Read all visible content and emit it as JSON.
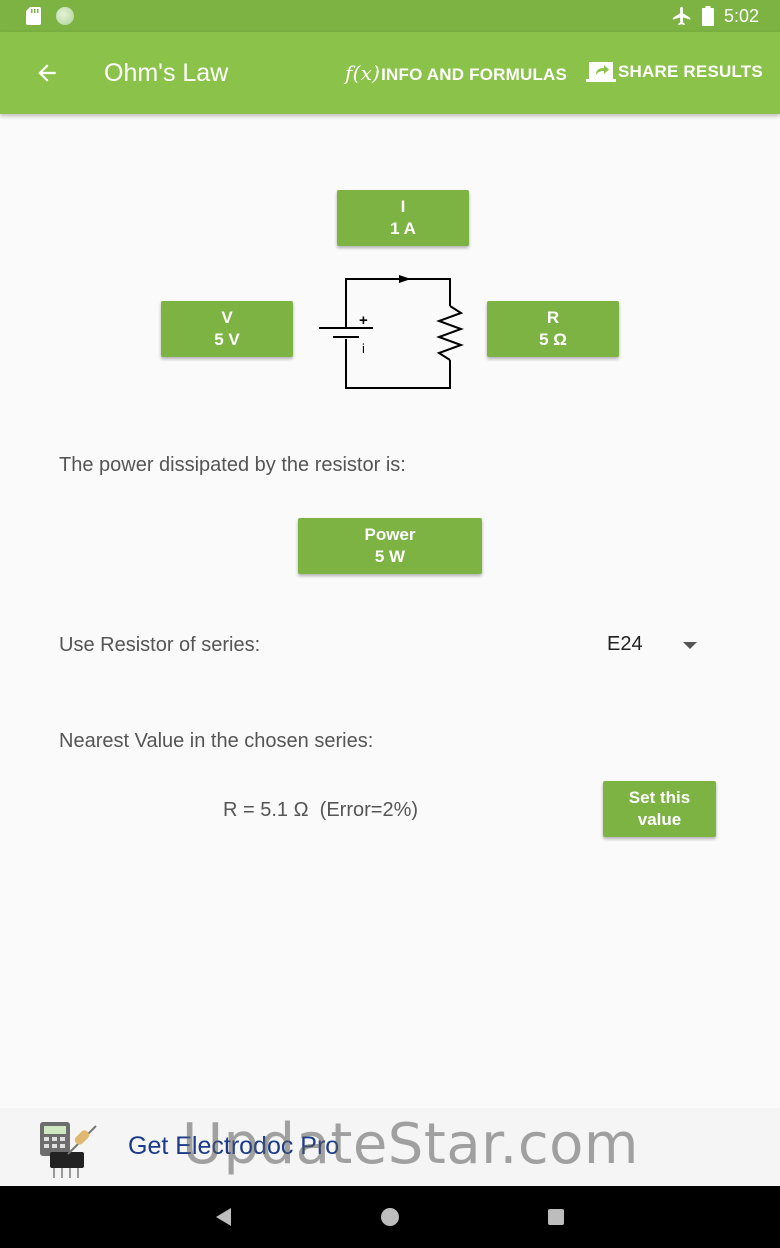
{
  "status_bar": {
    "time": "5:02"
  },
  "app_bar": {
    "title": "Ohm's Law",
    "fx_symbol": "f(x)",
    "info_label": "INFO AND FORMULAS",
    "share_label": "SHARE RESULTS"
  },
  "circuit": {
    "current": {
      "label": "I",
      "value": "1 A"
    },
    "voltage": {
      "label": "V",
      "value": "5 V"
    },
    "resistance": {
      "label": "R",
      "value": "5 Ω"
    },
    "plus_sign": "+",
    "minus_sign": "i"
  },
  "power": {
    "description": "The power dissipated by the resistor is:",
    "label": "Power",
    "value": "5 W"
  },
  "series": {
    "label": "Use Resistor of series:",
    "selected": "E24"
  },
  "nearest": {
    "label": "Nearest Value in the chosen series:",
    "result": "R = 5.1 Ω  (Error=2%)",
    "button_line1": "Set this",
    "button_line2": "value"
  },
  "ad": {
    "text": "Get Electrodoc Pro"
  },
  "watermark": "UpdateStar.com",
  "colors": {
    "accent": "#8bc34a",
    "status": "#7cb342",
    "button": "#7cb342",
    "ad_text": "#1a3a8a"
  }
}
